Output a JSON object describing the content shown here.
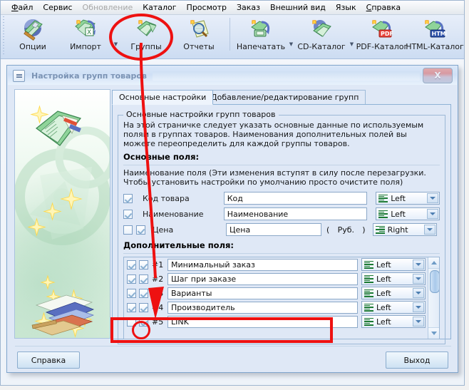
{
  "menubar": {
    "items": [
      {
        "label": "Файл",
        "accel": "Ф",
        "disabled": false
      },
      {
        "label": "Сервис",
        "disabled": false
      },
      {
        "label": "Обновление",
        "disabled": true
      },
      {
        "label": "Каталог",
        "disabled": false
      },
      {
        "label": "Просмотр",
        "disabled": false
      },
      {
        "label": "Заказ",
        "disabled": false
      },
      {
        "label": "Внешний вид",
        "disabled": false
      },
      {
        "label": "Язык",
        "disabled": false
      },
      {
        "label": "Справка",
        "accel": "С",
        "disabled": false
      }
    ]
  },
  "toolbar": {
    "buttons": [
      {
        "label": "Опции",
        "icon": "options-wrench-icon",
        "dropdown": false
      },
      {
        "label": "Импорт",
        "icon": "import-excel-icon",
        "dropdown": true
      },
      {
        "label": "Группы",
        "icon": "groups-folder-icon",
        "dropdown": false
      },
      {
        "label": "Отчеты",
        "icon": "reports-magnifier-icon",
        "dropdown": false
      },
      {
        "label": "Напечатать",
        "icon": "print-icon",
        "dropdown": true
      },
      {
        "label": "CD-Каталог",
        "icon": "cd-catalog-icon",
        "dropdown": true
      },
      {
        "label": "PDF-Каталог",
        "icon": "pdf-catalog-icon",
        "dropdown": false
      },
      {
        "label": "HTML-Каталог",
        "icon": "html-catalog-icon",
        "dropdown": false
      }
    ]
  },
  "dialog": {
    "title": "Настройка групп товаров",
    "close_label": "X",
    "tabs": [
      {
        "label": "Основные настройки",
        "active": true
      },
      {
        "label": "Добавление/редактирование групп",
        "active": false
      }
    ],
    "groupbox": {
      "legend": "Основные настройки групп товаров",
      "description": "На этой страничке следует указать основные данные по используемым полям в группах товаров. Наименования дополнительных полей вы можете переопределить для каждой группы товаров.",
      "main_fields_heading": "Основные поля:",
      "field_name_note": "Наименование поля (Эти изменения вступят в силу после перезагрузки. Чтобы установить настройки по умолчанию просто очистите поля)",
      "main_fields": [
        {
          "checked1": true,
          "has_second_checkbox": false,
          "checked2": false,
          "label": "Код товара",
          "value": "Код",
          "align": "Left",
          "align_icon": "align-left-icon",
          "suffix": null
        },
        {
          "checked1": true,
          "has_second_checkbox": false,
          "checked2": false,
          "label": "Наименование",
          "value": "Наименование",
          "align": "Left",
          "align_icon": "align-left-icon",
          "suffix": null
        },
        {
          "checked1": false,
          "has_second_checkbox": true,
          "checked2": true,
          "label": "Цена",
          "value": "Цена",
          "align": "Right",
          "align_icon": "align-right-icon",
          "suffix": "Руб."
        }
      ],
      "extra_fields_heading": "Дополнительные поля:",
      "extra_fields": [
        {
          "checked1": true,
          "checked2": true,
          "num": "#1",
          "value": "Минимальный заказ",
          "align": "Left",
          "align_icon": "align-left-icon"
        },
        {
          "checked1": true,
          "checked2": true,
          "num": "#2",
          "value": "Шаг при заказе",
          "align": "Left",
          "align_icon": "align-left-icon"
        },
        {
          "checked1": true,
          "checked2": true,
          "num": "#3",
          "value": "Варианты",
          "align": "Left",
          "align_icon": "align-left-icon"
        },
        {
          "checked1": true,
          "checked2": true,
          "num": "#4",
          "value": "Производитель",
          "align": "Left",
          "align_icon": "align-left-icon"
        },
        {
          "checked1": false,
          "checked2": true,
          "num": "#5",
          "value": "LINK",
          "align": "Left",
          "align_icon": "align-left-icon"
        }
      ],
      "paren_open": "(",
      "paren_close": ")"
    },
    "buttons": {
      "help": "Справка",
      "exit": "Выход"
    }
  },
  "annotations": {
    "circle_toolbar": "red-circle-around-groups-button",
    "arrow": "red-arrow-to-link-row",
    "rect_link": "red-rectangle-around-link-row",
    "circle_num5": "red-circle-around-field-number-5"
  },
  "colors": {
    "annotation_red": "#ee1111",
    "dialog_bg": "#dfe8f6",
    "panel_border": "#8fb2d6",
    "align_icon_green": "#1c7a34"
  }
}
